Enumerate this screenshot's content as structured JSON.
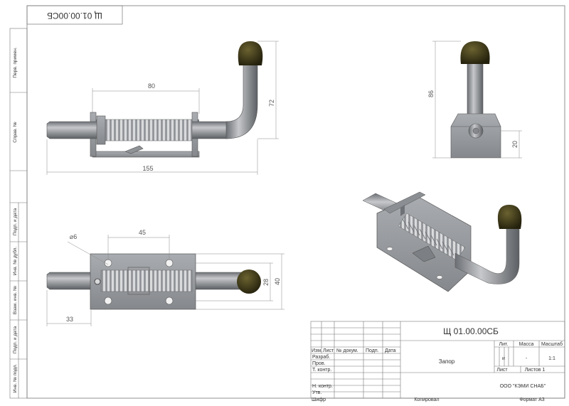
{
  "drawing": {
    "stamp_code_rotated": "Щ 01.00.00СБ",
    "side_labels": [
      "Перв. примен.",
      "Справ. №",
      "Подп. и дата",
      "Инв. № дубл.",
      "Взам. инв. №",
      "Подп. и дата",
      "Инв. № подл."
    ],
    "front_view": {
      "dim_spring": "80",
      "dim_total": "155",
      "dim_height": "72"
    },
    "side_view": {
      "dim_height": "86",
      "dim_base": "20"
    },
    "top_view": {
      "dim_hole": "⌀6",
      "dim_holes": "45",
      "dim_left": "33",
      "dim_inner": "28",
      "dim_outer": "40"
    }
  },
  "title_block": {
    "designation": "Щ 01.00.00СБ",
    "name": "Запор",
    "col_lit": "Лит.",
    "col_mass": "Масса",
    "col_scale": "Масштаб",
    "lit_value": "и",
    "mass_value": "-",
    "scale_value": "1:1",
    "header": {
      "izm": "Изм.",
      "list": "Лист",
      "doc": "№ докум.",
      "sign": "Подп.",
      "date": "Дата"
    },
    "rows": [
      "Разраб.",
      "Пров.",
      "Т. контр.",
      "Н. контр.",
      "Утв."
    ],
    "sheet_label": "Лист",
    "sheets_label": "Листов 1",
    "company": "ООО \"КЭМИ СНАБ\"",
    "copied": "Копировал",
    "format": "Формат A3"
  },
  "bottom_left_label": "Шифр",
  "colors": {
    "frame": "#777777",
    "metal": "#9ea1a5",
    "metal_dark": "#6b6e73",
    "knob": "#3f3a1a",
    "dim_line": "#888888"
  }
}
